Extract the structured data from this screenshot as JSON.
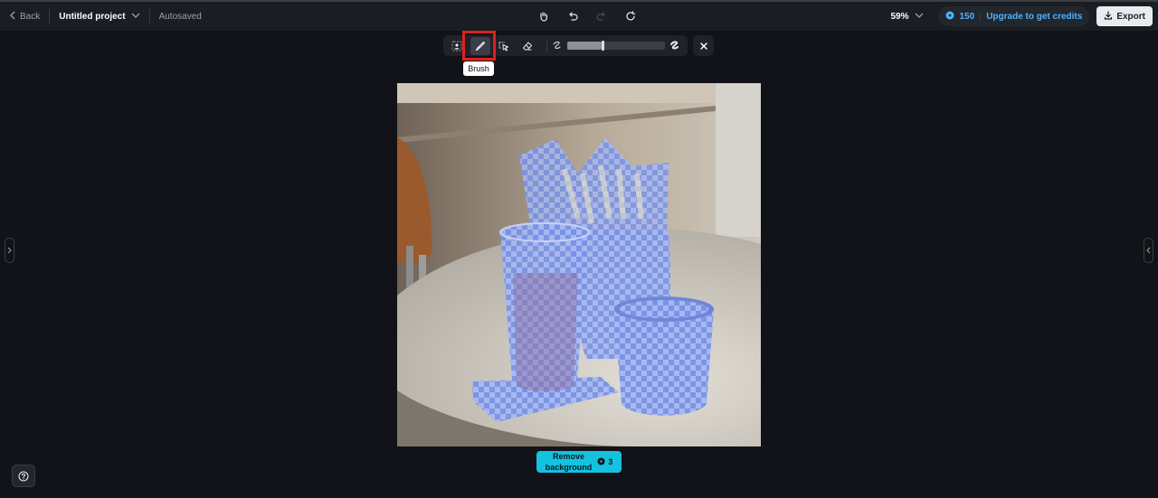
{
  "topbar": {
    "back_label": "Back",
    "project_title": "Untitled project",
    "save_status": "Autosaved",
    "zoom": "59%",
    "credits": "150",
    "upgrade_label": "Upgrade to get credits",
    "export_label": "Export"
  },
  "toolbar": {
    "active_tool": "Brush",
    "tooltip": "Brush",
    "brush_size_fraction": 0.35
  },
  "action": {
    "label_line1": "Remove",
    "label_line2": "background",
    "cost": "3"
  },
  "colors": {
    "accent": "#14c2e0",
    "link": "#4fb3ff",
    "highlight": "#e02020",
    "mask": "#5577ee"
  }
}
